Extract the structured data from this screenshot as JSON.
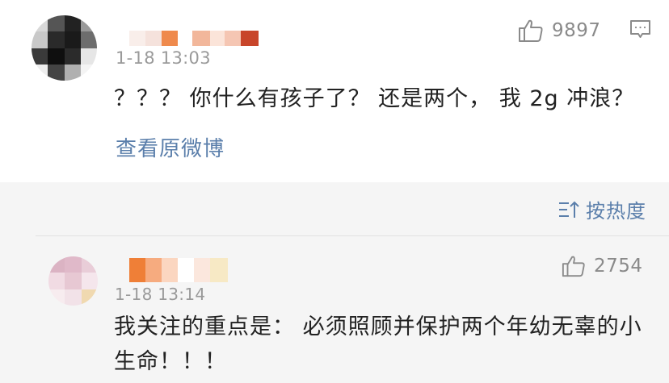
{
  "comments": [
    {
      "timestamp": "1-18 13:03",
      "likes": "9897",
      "text": "？？？ 你什么有孩子了？ 还是两个， 我 2g 冲浪？",
      "view_original": "查看原微博"
    },
    {
      "timestamp": "1-18 13:14",
      "likes": "2754",
      "text": "我关注的重点是： 必须照顾并保护两个年幼无辜的小生命！！！"
    }
  ],
  "sort": {
    "label": "按热度"
  },
  "colors": {
    "link": "#5b7fab",
    "muted": "#9a9a9a",
    "text": "#222222"
  },
  "icons": {
    "like": "thumbs-up-icon",
    "comment": "comment-bubble-icon",
    "sort": "sort-icon"
  }
}
